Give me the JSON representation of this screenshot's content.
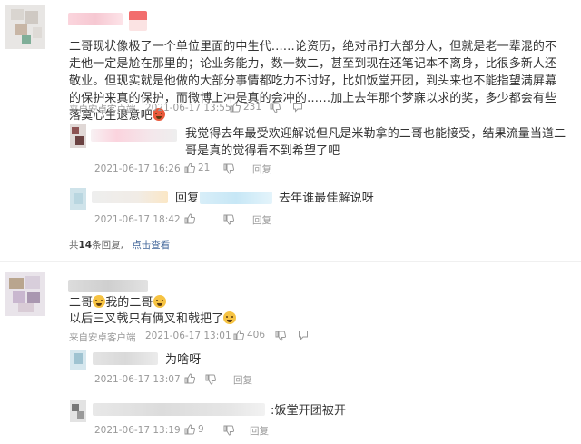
{
  "comments": [
    {
      "text": "二哥现状像极了一个单位里面的中生代……论资历，绝对吊打大部分人，但就是老一辈混的不走他一定是尬在那里的；论业务能力，数一数二，甚至到现在还笔记本不离身，比很多新人还敬业。但现实就是他做的大部分事情都吃力不讨好，比如饭堂开团，到头来也不能指望满屏幕的保护来真的保护，而微博上冲是真的会冲的……加上去年那个梦寐以求的奖，多少都会有些落寞心生退意吧",
      "source": "来自安卓客户端",
      "time": "2021-06-17 13:55",
      "likes": "231",
      "replies": [
        {
          "text": "我觉得去年最受欢迎解说但凡是米勒拿的二哥也能接受，结果流量当道二哥是真的觉得看不到希望了吧",
          "time": "2021-06-17 16:26",
          "likes": "21",
          "reply_label": "回复"
        },
        {
          "prefix": "回复",
          "text": "去年谁最佳解说呀",
          "time": "2021-06-17 18:42",
          "reply_label": "回复"
        }
      ],
      "total_prefix": "共",
      "total_count": "14",
      "total_suffix": "条回复,",
      "view_link": "点击查看"
    },
    {
      "line1_a": "二哥",
      "line1_b": "我的二哥",
      "line2": "以后三叉戟只有俩叉和戟把了",
      "source": "来自安卓客户端",
      "time": "2021-06-17 13:01",
      "likes": "406",
      "replies": [
        {
          "text": "为啥呀",
          "time": "2021-06-17 13:07",
          "reply_label": "回复"
        },
        {
          "text": ":饭堂开团被开",
          "time": "2021-06-17 13:19",
          "likes": "9",
          "reply_label": "回复"
        }
      ]
    }
  ],
  "colors": {
    "link": "#406599",
    "meta": "#999999",
    "text": "#333333"
  },
  "icons": [
    "thumbs-up-icon",
    "thumbs-down-icon",
    "emoji-icon"
  ]
}
